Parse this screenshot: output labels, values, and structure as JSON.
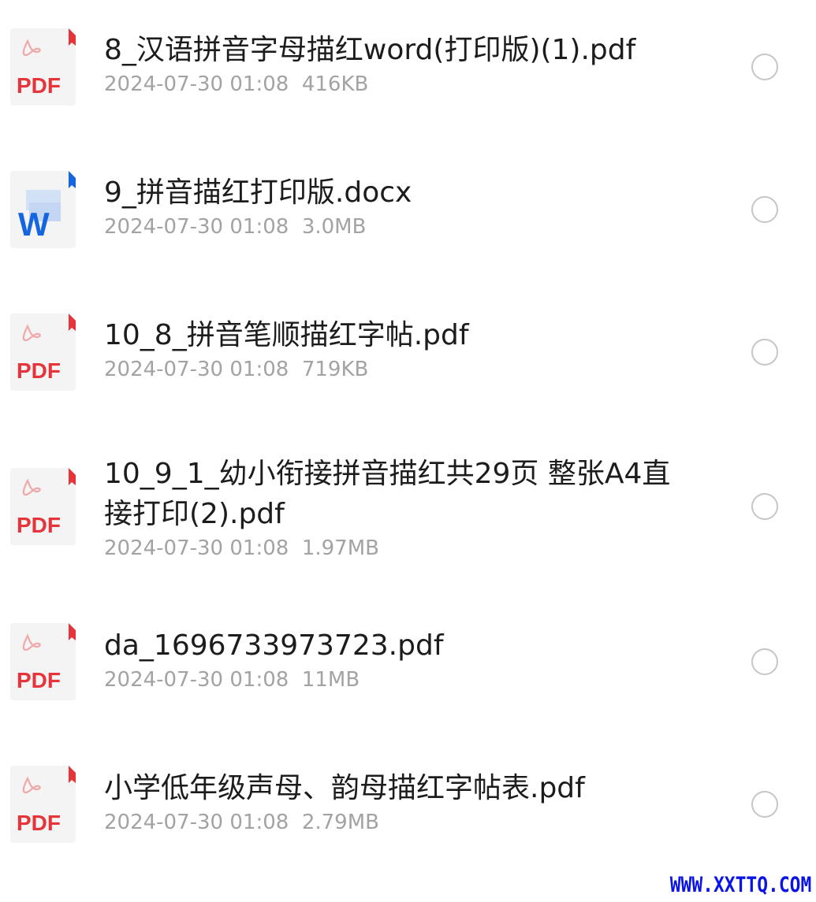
{
  "files": [
    {
      "name": "8_汉语拼音字母描红word(打印版)(1).pdf",
      "date": "2024-07-30 01:08",
      "size": "416KB",
      "type": "pdf",
      "icon_label": "PDF"
    },
    {
      "name": "9_拼音描红打印版.docx",
      "date": "2024-07-30 01:08",
      "size": "3.0MB",
      "type": "docx",
      "icon_label": "W"
    },
    {
      "name": "10_8_拼音笔顺描红字帖.pdf",
      "date": "2024-07-30 01:08",
      "size": "719KB",
      "type": "pdf",
      "icon_label": "PDF"
    },
    {
      "name": "10_9_1_幼小衔接拼音描红共29页 整张A4直接打印(2).pdf",
      "date": "2024-07-30 01:08",
      "size": "1.97MB",
      "type": "pdf",
      "icon_label": "PDF"
    },
    {
      "name": "da_1696733973723.pdf",
      "date": "2024-07-30 01:08",
      "size": "11MB",
      "type": "pdf",
      "icon_label": "PDF"
    },
    {
      "name": "小学低年级声母、韵母描红字帖表.pdf",
      "date": "2024-07-30 01:08",
      "size": "2.79MB",
      "type": "pdf",
      "icon_label": "PDF"
    }
  ],
  "watermark": "WWW.XXTTQ.COM",
  "colors": {
    "pdf_red": "#e5343a",
    "word_blue": "#1565e0",
    "meta_gray": "#a3a3a3",
    "radio_border": "#c6c6c6"
  }
}
